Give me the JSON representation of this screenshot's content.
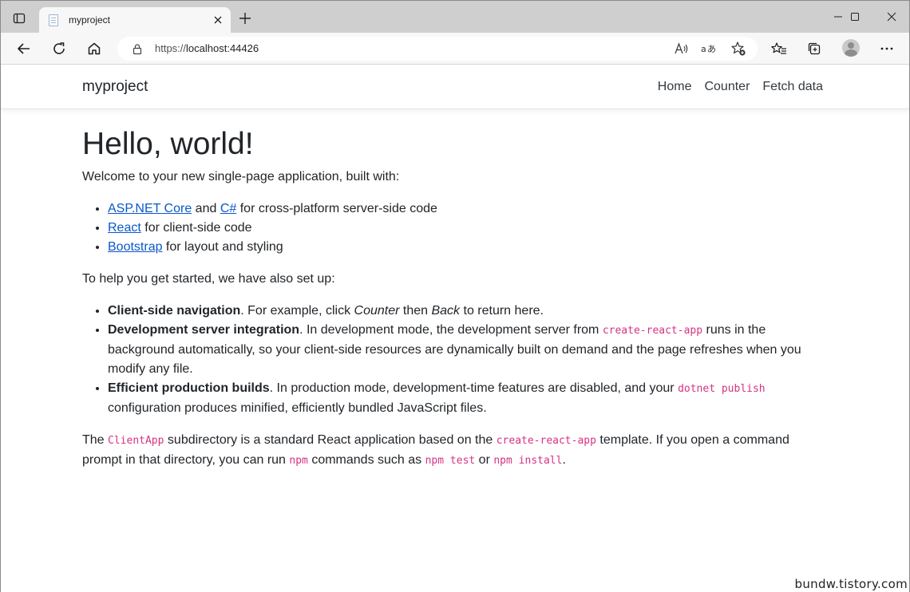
{
  "browser": {
    "tab_title": "myproject",
    "url_scheme": "https://",
    "url_host": "localhost:44426"
  },
  "navbar": {
    "brand": "myproject",
    "links": [
      "Home",
      "Counter",
      "Fetch data"
    ]
  },
  "content": {
    "heading": "Hello, world!",
    "intro": "Welcome to your new single-page application, built with:",
    "built_with": [
      {
        "link1": "ASP.NET Core",
        "mid": " and ",
        "link2": "C#",
        "text": " for cross-platform server-side code"
      },
      {
        "link1": "React",
        "text": " for client-side code"
      },
      {
        "link1": "Bootstrap",
        "text": " for layout and styling"
      }
    ],
    "setup_intro": "To help you get started, we have also set up:",
    "features": [
      {
        "title": "Client-side navigation",
        "t1": ". For example, click ",
        "em1": "Counter",
        "t2": " then ",
        "em2": "Back",
        "t3": " to return here."
      },
      {
        "title": "Development server integration",
        "t1": ". In development mode, the development server from ",
        "code1": "create-react-app",
        "t2": " runs in the background automatically, so your client-side resources are dynamically built on demand and the page refreshes when you modify any file."
      },
      {
        "title": "Efficient production builds",
        "t1": ". In production mode, development-time features are disabled, and your ",
        "code1": "dotnet publish",
        "t2": " configuration produces minified, efficiently bundled JavaScript files."
      }
    ],
    "closing": {
      "t1": "The ",
      "code1": "ClientApp",
      "t2": " subdirectory is a standard React application based on the ",
      "code2": "create-react-app",
      "t3": " template. If you open a command prompt in that directory, you can run ",
      "code3": "npm",
      "t4": " commands such as ",
      "code4": "npm test",
      "t5": " or ",
      "code5": "npm install",
      "t6": "."
    }
  },
  "watermark": "bundw.tistory.com",
  "colors": {
    "link": "#0a58ca",
    "code": "#d63384",
    "text": "#212529",
    "titlebar": "#cfcfcf"
  }
}
